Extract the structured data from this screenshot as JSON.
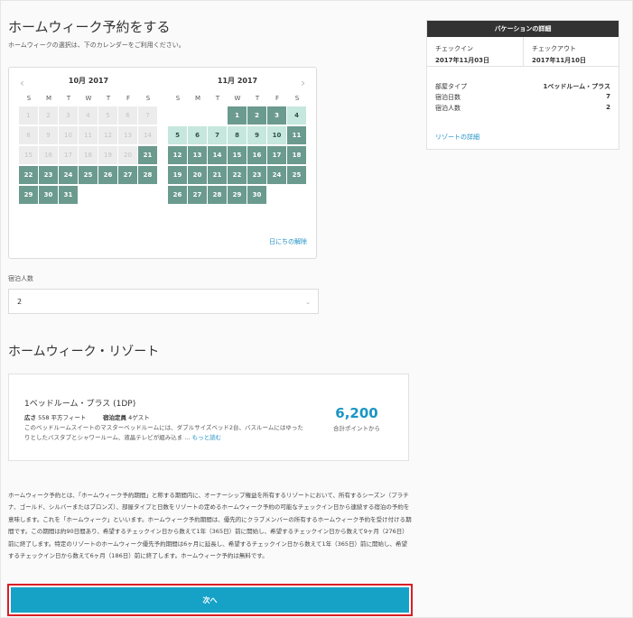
{
  "header": {
    "title": "ホームウィーク予約をする",
    "subtitle": "ホームウィークの選択は、下のカレンダーをご利用ください。"
  },
  "calendar": {
    "prev_icon": "‹",
    "next_icon": "›",
    "clear_label": "日にちの解除",
    "weekdays": [
      "S",
      "M",
      "T",
      "W",
      "T",
      "F",
      "S"
    ],
    "months": [
      {
        "title": "10月 2017",
        "days": [
          {
            "n": "1",
            "s": "past"
          },
          {
            "n": "2",
            "s": "past"
          },
          {
            "n": "3",
            "s": "past"
          },
          {
            "n": "4",
            "s": "past"
          },
          {
            "n": "5",
            "s": "past"
          },
          {
            "n": "6",
            "s": "past"
          },
          {
            "n": "7",
            "s": "past"
          },
          {
            "n": "8",
            "s": "past"
          },
          {
            "n": "9",
            "s": "past"
          },
          {
            "n": "10",
            "s": "past"
          },
          {
            "n": "11",
            "s": "past"
          },
          {
            "n": "12",
            "s": "past"
          },
          {
            "n": "13",
            "s": "past"
          },
          {
            "n": "14",
            "s": "past"
          },
          {
            "n": "15",
            "s": "past"
          },
          {
            "n": "16",
            "s": "past"
          },
          {
            "n": "17",
            "s": "past"
          },
          {
            "n": "18",
            "s": "past"
          },
          {
            "n": "19",
            "s": "past"
          },
          {
            "n": "20",
            "s": "past"
          },
          {
            "n": "21",
            "s": "avail"
          },
          {
            "n": "22",
            "s": "avail"
          },
          {
            "n": "23",
            "s": "avail"
          },
          {
            "n": "24",
            "s": "avail"
          },
          {
            "n": "25",
            "s": "avail"
          },
          {
            "n": "26",
            "s": "avail"
          },
          {
            "n": "27",
            "s": "avail"
          },
          {
            "n": "28",
            "s": "avail"
          },
          {
            "n": "29",
            "s": "avail"
          },
          {
            "n": "30",
            "s": "avail"
          },
          {
            "n": "31",
            "s": "avail"
          }
        ]
      },
      {
        "title": "11月 2017",
        "days": [
          {
            "n": "",
            "s": "empty"
          },
          {
            "n": "",
            "s": "empty"
          },
          {
            "n": "",
            "s": "empty"
          },
          {
            "n": "1",
            "s": "avail"
          },
          {
            "n": "2",
            "s": "avail"
          },
          {
            "n": "3",
            "s": "avail"
          },
          {
            "n": "4",
            "s": "light"
          },
          {
            "n": "5",
            "s": "light"
          },
          {
            "n": "6",
            "s": "light"
          },
          {
            "n": "7",
            "s": "light"
          },
          {
            "n": "8",
            "s": "light"
          },
          {
            "n": "9",
            "s": "light"
          },
          {
            "n": "10",
            "s": "light"
          },
          {
            "n": "11",
            "s": "avail"
          },
          {
            "n": "12",
            "s": "avail"
          },
          {
            "n": "13",
            "s": "avail"
          },
          {
            "n": "14",
            "s": "avail"
          },
          {
            "n": "15",
            "s": "avail"
          },
          {
            "n": "16",
            "s": "avail"
          },
          {
            "n": "17",
            "s": "avail"
          },
          {
            "n": "18",
            "s": "avail"
          },
          {
            "n": "19",
            "s": "avail"
          },
          {
            "n": "20",
            "s": "avail"
          },
          {
            "n": "21",
            "s": "avail"
          },
          {
            "n": "22",
            "s": "avail"
          },
          {
            "n": "23",
            "s": "avail"
          },
          {
            "n": "24",
            "s": "avail"
          },
          {
            "n": "25",
            "s": "avail"
          },
          {
            "n": "26",
            "s": "avail"
          },
          {
            "n": "27",
            "s": "avail"
          },
          {
            "n": "28",
            "s": "avail"
          },
          {
            "n": "29",
            "s": "avail"
          },
          {
            "n": "30",
            "s": "avail"
          }
        ]
      }
    ]
  },
  "guests": {
    "label": "宿泊人数",
    "value": "2",
    "chevron": "⌄"
  },
  "resort": {
    "heading": "ホームウィーク・リゾート",
    "room_name": "1ベッドルーム・プラス (1DP)",
    "area_label": "広さ",
    "area_value": "558 平方フィート",
    "capacity_label": "宿泊定員",
    "capacity_value": "4ゲスト",
    "description": "このベッドルームスイートのマスターベッドルームには、ダブルサイズベッド2台、バスルームにはゆったりとしたバスタブとシャワールーム、液晶テレビが組み込ま ...",
    "more_label": "もっと読む",
    "points_value": "6,200",
    "points_label": "合計ポイントから"
  },
  "info": {
    "text": "ホームウィーク予約とは、「ホームウィーク予約期間」と称する期間内に、オーナーシップ権益を所有するリゾートにおいて、所有するシーズン（プラチナ、ゴールド、シルバーまたはブロンズ）、部屋タイプと日数をリゾートの定めるホームウィーク予約の可能なチェックイン日から連続する宿泊の予約を意味します。これを「ホームウィーク」といいます。ホームウィーク予約期間は、優先的にクラブメンバーの所有するホームウィーク予約を受け付ける期間です。この期間は約90日間あり、希望するチェックイン日から数えて1年（365日）前に開始し、希望するチェックイン日から数えて9ヶ月（276日）前に終了します。特定のリゾートのホームウィーク優先予約期間は6ヶ月に延長し、希望するチェックイン日から数えて1年（365日）前に開始し、希望するチェックイン日から数えて6ヶ月（186日）前に終了します。ホームウィーク予約は無料です。"
  },
  "next_button": {
    "label": "次へ"
  },
  "vacation": {
    "title": "バケーションの詳細",
    "checkin_label": "チェックイン",
    "checkin_value": "2017年11月03日",
    "checkout_label": "チェックアウト",
    "checkout_value": "2017年11月10日",
    "rows": [
      {
        "label": "部屋タイプ",
        "value": "1ベッドルーム・プラス"
      },
      {
        "label": "宿泊日数",
        "value": "7"
      },
      {
        "label": "宿泊人数",
        "value": "2"
      }
    ],
    "resort_link": "リゾートの詳細"
  },
  "colors": {
    "accent": "#16a2c7",
    "available_day": "#6b9a8f",
    "selected_range": "#c5e7de",
    "highlight_border": "#d81f26"
  }
}
